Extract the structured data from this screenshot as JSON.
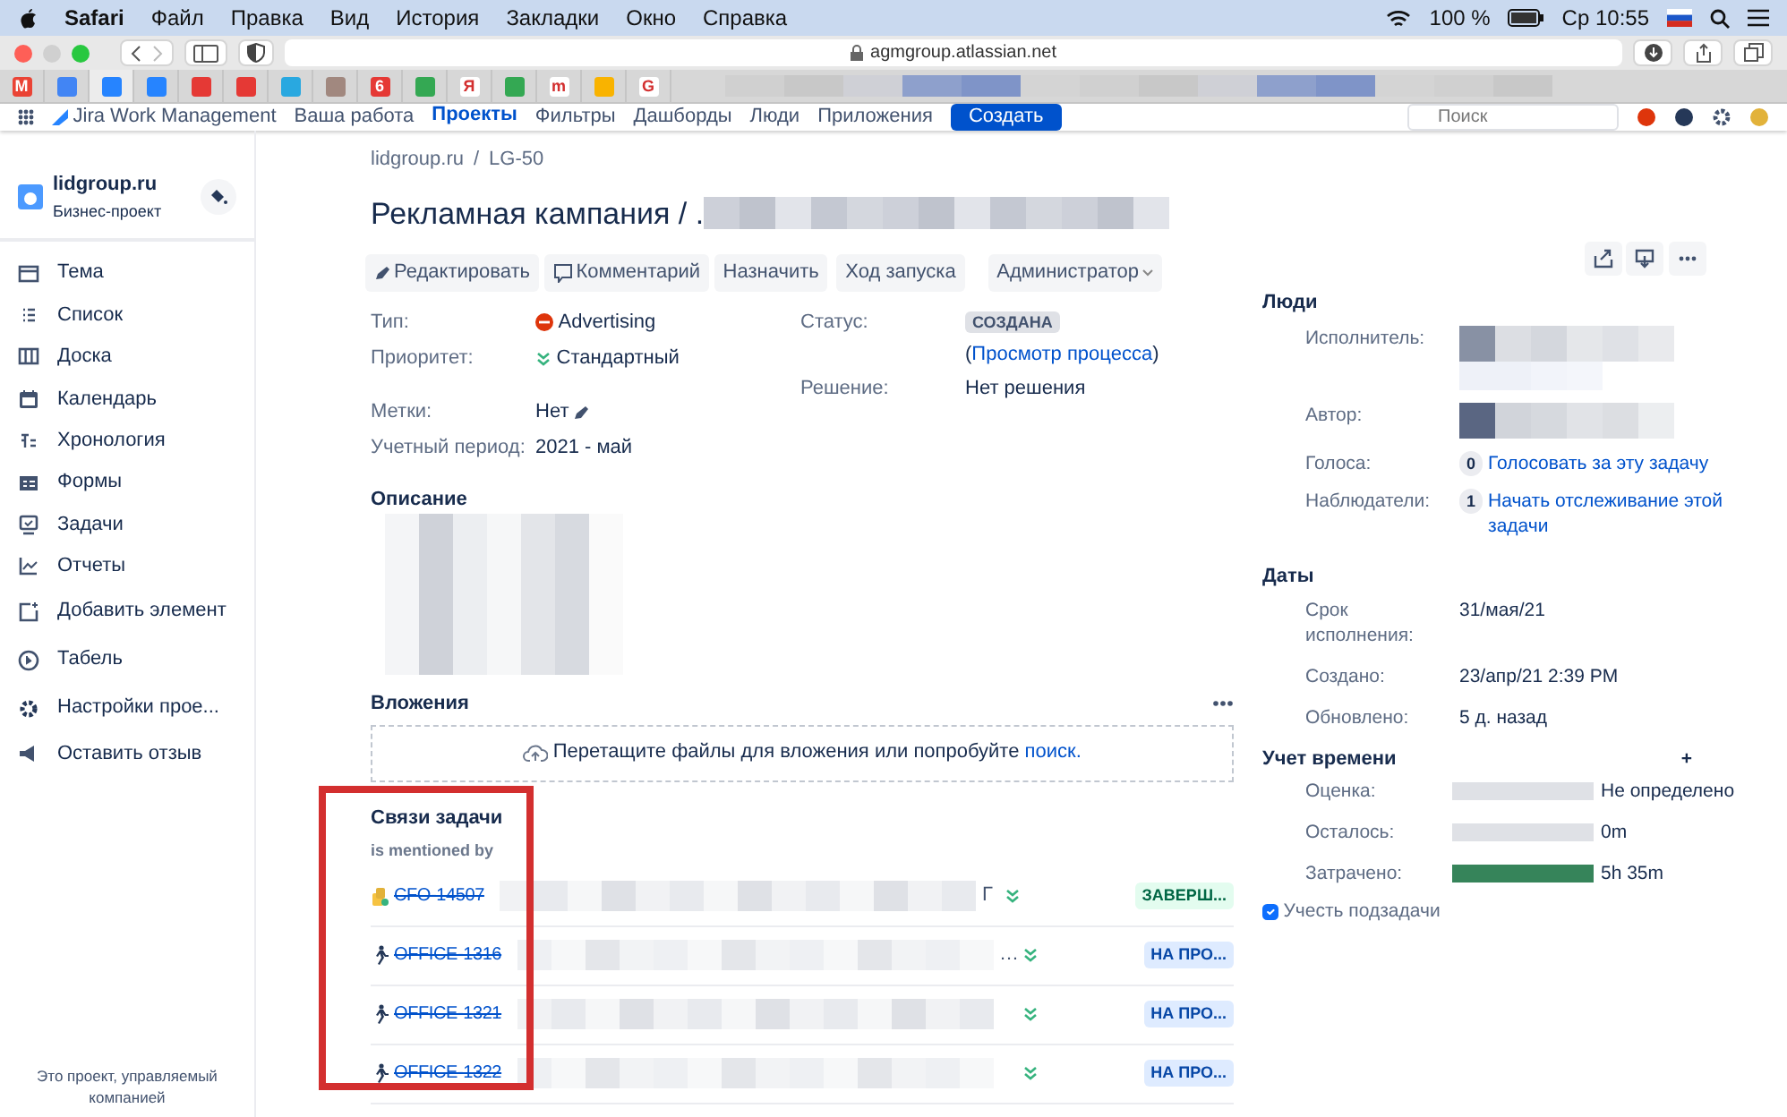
{
  "menubar": {
    "app": "Safari",
    "items": [
      "Файл",
      "Правка",
      "Вид",
      "История",
      "Закладки",
      "Окно",
      "Справка"
    ],
    "battery": "100 %",
    "clock": "Ср 10:55"
  },
  "browser": {
    "url": "agmgroup.atlassian.net"
  },
  "favorites": [
    {
      "color": "#ea4335",
      "glyph": "M"
    },
    {
      "color": "#4285f4"
    },
    {
      "color": "#2684ff",
      "selected": true
    },
    {
      "color": "#2684ff"
    },
    {
      "color": "#e53935"
    },
    {
      "color": "#e53935"
    },
    {
      "color": "#29a8e0"
    },
    {
      "color": "#a1887f"
    },
    {
      "color": "#e53935",
      "glyph": "6"
    },
    {
      "color": "#34a853"
    },
    {
      "color": "#ffffff",
      "glyph": "Я"
    },
    {
      "color": "#34a853"
    },
    {
      "color": "#ffffff",
      "glyph": "m"
    },
    {
      "color": "#f9b300"
    },
    {
      "color": "#ffffff",
      "glyph": "G"
    }
  ],
  "jira_nav": {
    "product": "Jira Work Management",
    "menus": [
      {
        "label": "Ваша работа",
        "selected": false
      },
      {
        "label": "Проекты",
        "selected": true
      },
      {
        "label": "Фильтры",
        "selected": false
      },
      {
        "label": "Дашборды",
        "selected": false
      },
      {
        "label": "Люди",
        "selected": false
      },
      {
        "label": "Приложения",
        "selected": false
      }
    ],
    "create": "Создать",
    "search_placeholder": "Поиск"
  },
  "sidebar": {
    "project": "lidgroup.ru",
    "project_type": "Бизнес-проект",
    "items": [
      {
        "label": "Тема",
        "kind": "summary"
      },
      {
        "label": "Список",
        "kind": "list"
      },
      {
        "label": "Доска",
        "kind": "board"
      },
      {
        "label": "Календарь",
        "kind": "calendar"
      },
      {
        "label": "Хронология",
        "kind": "timeline"
      },
      {
        "label": "Формы",
        "kind": "forms"
      },
      {
        "label": "Задачи",
        "kind": "issues"
      },
      {
        "label": "Отчеты",
        "kind": "reports"
      },
      {
        "label": "Добавить элемент",
        "kind": "add"
      },
      {
        "label": "Табель",
        "kind": "clock"
      },
      {
        "label": "Настройки прое...",
        "kind": "settings"
      },
      {
        "label": "Оставить отзыв",
        "kind": "feedback"
      }
    ],
    "footer": "Это проект, управляемый компанией"
  },
  "issue": {
    "breadcrumbs": [
      "lidgroup.ru",
      "LG-50"
    ],
    "breadcrumb_separator": "/",
    "title": "Рекламная кампания / .",
    "actions": [
      {
        "label": "Редактировать",
        "kind": "edit"
      },
      {
        "label": "Комментарий",
        "kind": "comment"
      },
      {
        "label": "Назначить",
        "kind": "plain"
      },
      {
        "label": "Ход запуска",
        "kind": "plain"
      },
      {
        "label": "Администратор",
        "kind": "dropdown"
      }
    ],
    "fields": [
      {
        "label": "Тип:",
        "value": "Advertising",
        "kind": "type"
      },
      {
        "label": "Приоритет:",
        "value": "Стандартный",
        "kind": "priority"
      },
      {
        "label": "Метки:",
        "value": "Нет",
        "kind": "labels"
      },
      {
        "label": "Учетный период:",
        "value": "2021 - май",
        "kind": "plain"
      }
    ],
    "status": {
      "label": "Статус:",
      "value": "СОЗДАНА",
      "before": "(",
      "link": "Просмотр процесса",
      "after": ")"
    },
    "resolution": {
      "label": "Решение:",
      "value": "Нет решения"
    },
    "description": {
      "heading": "Описание"
    },
    "attachments": {
      "heading": "Вложения",
      "drop_text": "Перетащите файлы для вложения или попробуйте",
      "drop_link": "поиск."
    },
    "links": {
      "heading": "Связи задачи",
      "relation": "is mentioned by",
      "rows": [
        {
          "key": "CFO-14507",
          "kind": "task",
          "resolved": true,
          "summary": "Г",
          "status": "ЗАВЕРШ...",
          "color": "#e3fcef"
        },
        {
          "key": "OFFICE-1316",
          "kind": "runner",
          "resolved": true,
          "summary": "…",
          "status": "НА ПРО...",
          "color": "#deebff"
        },
        {
          "key": "OFFICE-1321",
          "kind": "runner",
          "resolved": true,
          "status": "НА ПРО...",
          "color": "#deebff"
        },
        {
          "key": "OFFICE-1322",
          "kind": "runner",
          "resolved": true,
          "status": "НА ПРО...",
          "color": "#deebff"
        }
      ]
    }
  },
  "people": {
    "heading": "Люди",
    "assignee": "Исполнитель:",
    "reporter": "Автор:",
    "votes": {
      "label": "Голоса:",
      "count": "0",
      "link": "Голосовать за эту задачу"
    },
    "watchers": {
      "label": "Наблюдатели:",
      "count": "1",
      "link": "Начать отслеживание этой задачи"
    }
  },
  "dates": {
    "heading": "Даты",
    "rows": [
      {
        "label": "Срок исполнения:",
        "value": "31/мая/21"
      },
      {
        "label": "Создано:",
        "value": "23/апр/21 2:39 PM"
      },
      {
        "label": "Обновлено:",
        "value": "5 д. назад"
      }
    ]
  },
  "time_tracking": {
    "heading": "Учет времени",
    "add": "+",
    "rows": [
      {
        "label": "Оценка:",
        "value": "Не определено",
        "level": 0
      },
      {
        "label": "Осталось:",
        "value": "0m",
        "level": 0
      },
      {
        "label": "Затрачено:",
        "value": "5h 35m",
        "level": 1
      }
    ],
    "include_subtasks": {
      "label": "Учесть подзадачи",
      "checked": true
    }
  }
}
